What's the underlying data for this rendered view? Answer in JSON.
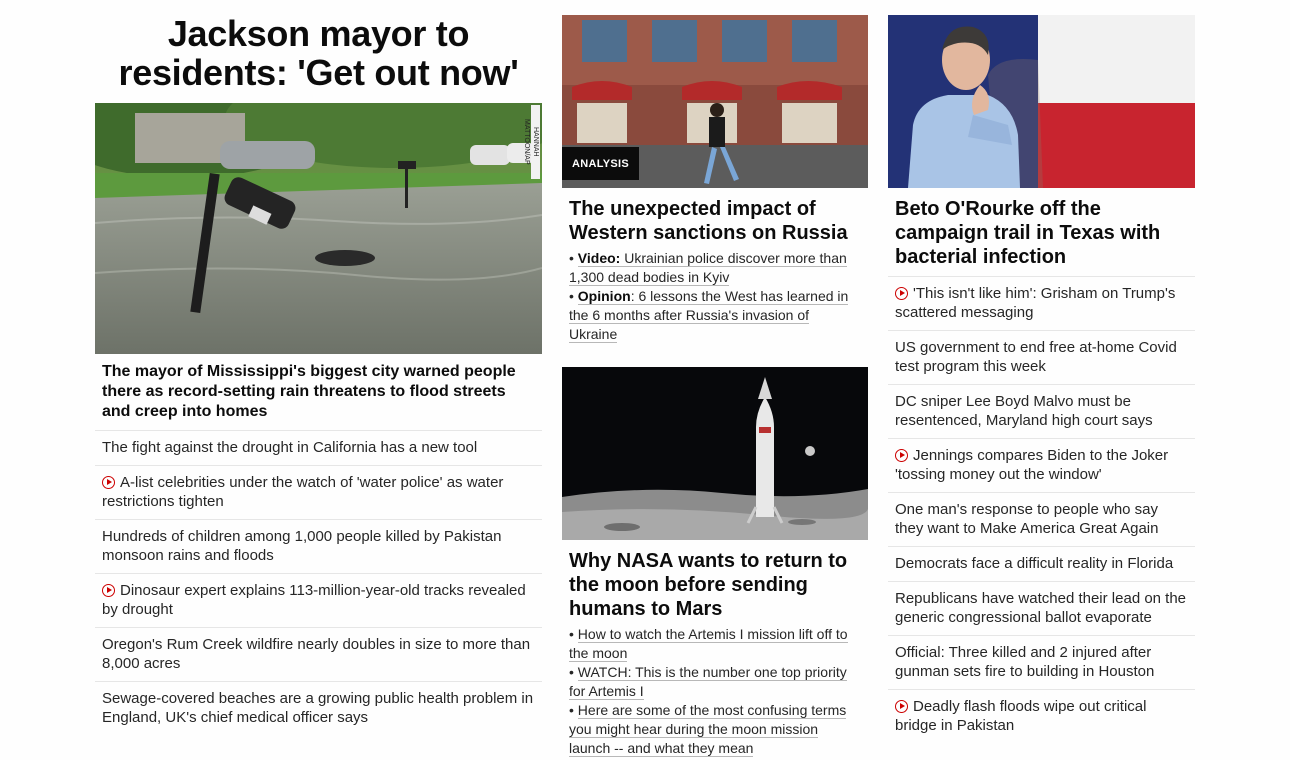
{
  "left_column": {
    "headline": "Jackson mayor to residents: 'Get out now'",
    "photo_credit": "HANNAH MATTOON/AP",
    "lead_text": "The mayor of Mississippi's biggest city warned people there as record-setting rain threatens to flood streets and creep into homes",
    "items": [
      {
        "text": "The fight against the drought in California has a new tool",
        "video": false
      },
      {
        "text": "A-list celebrities under the watch of 'water police' as water restrictions tighten",
        "video": true
      },
      {
        "text": "Hundreds of children among 1,000 people killed by Pakistan monsoon rains and floods",
        "video": false
      },
      {
        "text": "Dinosaur expert explains 113-million-year-old tracks revealed by drought",
        "video": true
      },
      {
        "text": "Oregon's Rum Creek wildfire nearly doubles in size to more than 8,000 acres",
        "video": false
      },
      {
        "text": "Sewage-covered beaches are a growing public health problem in England, UK's chief medical officer says",
        "video": false
      }
    ]
  },
  "middle_column": {
    "story1": {
      "badge": "ANALYSIS",
      "headline": "The unexpected impact of Western sanctions on Russia",
      "links": [
        {
          "prefix": "Video:",
          "text": " Ukrainian police discover more than 1,300 dead bodies in Kyiv"
        },
        {
          "prefix": "Opinion",
          "text": ": 6 lessons the West has learned in the 6 months after Russia's invasion of Ukraine"
        }
      ]
    },
    "story2": {
      "headline": "Why NASA wants to return to the moon before sending humans to Mars",
      "links": [
        {
          "text": "How to watch the Artemis I mission lift off to the moon"
        },
        {
          "text": "WATCH: This is the number one top priority for Artemis I"
        },
        {
          "text": "Here are some of the most confusing terms you might hear during the moon mission launch -- and what they mean"
        }
      ]
    }
  },
  "right_column": {
    "headline": "Beto O'Rourke off the campaign trail in Texas with bacterial infection",
    "items": [
      {
        "text": "'This isn't like him': Grisham on Trump's scattered messaging",
        "video": true
      },
      {
        "text": "US government to end free at-home Covid test program this week",
        "video": false
      },
      {
        "text": "DC sniper Lee Boyd Malvo must be resentenced, Maryland high court says",
        "video": false
      },
      {
        "text": "Jennings compares Biden to the Joker 'tossing money out the window'",
        "video": true
      },
      {
        "text": "One man's response to people who say they want to Make America Great Again",
        "video": false
      },
      {
        "text": "Democrats face a difficult reality in Florida",
        "video": false
      },
      {
        "text": "Republicans have watched their lead on the generic congressional ballot evaporate",
        "video": false
      },
      {
        "text": "Official: Three killed and 2 injured after gunman sets fire to building in Houston",
        "video": false
      },
      {
        "text": "Deadly flash floods wipe out critical bridge in Pakistan",
        "video": true
      }
    ]
  },
  "colors": {
    "video_red": "#cc0000",
    "badge_bg": "#0c0c0c",
    "divider": "#e6e6e6"
  }
}
